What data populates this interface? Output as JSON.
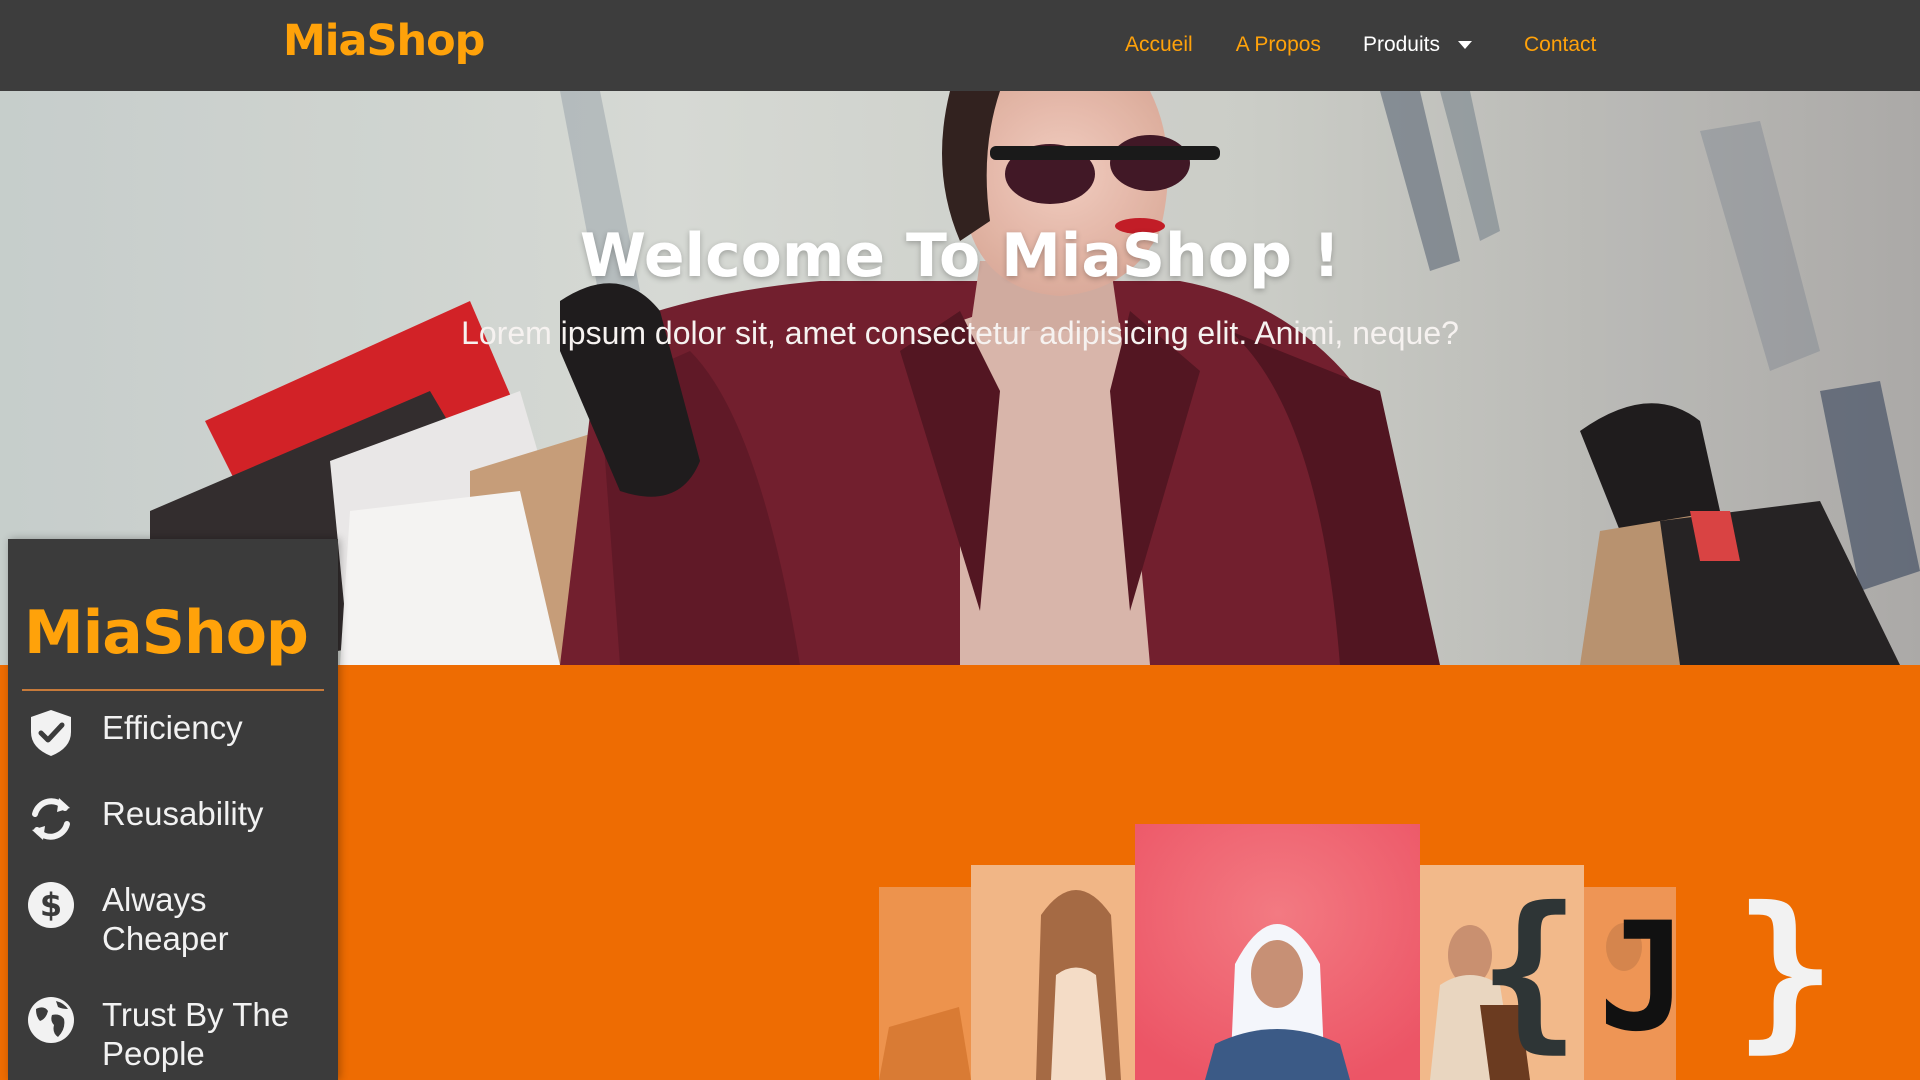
{
  "navbar": {
    "brand": "MiaShop",
    "links": [
      {
        "label": "Accueil"
      },
      {
        "label": "A Propos"
      },
      {
        "label": "Produits"
      },
      {
        "label": "Contact"
      }
    ]
  },
  "hero": {
    "title": "Welcome To MiaShop !",
    "subtitle": "Lorem ipsum dolor sit, amet consectetur adipisicing elit. Animi, neque?"
  },
  "side_card": {
    "brand": "MiaShop",
    "features": [
      {
        "label": "Efficiency",
        "icon": "shield-check-icon"
      },
      {
        "label": "Reusability",
        "icon": "refresh-icon"
      },
      {
        "label": "Always Cheaper",
        "icon": "dollar-icon"
      },
      {
        "label": "Trust By The People",
        "icon": "globe-icon"
      }
    ]
  },
  "logo": {
    "left_brace": "{",
    "letter": "J",
    "right_brace": "}"
  },
  "colors": {
    "navbar_bg": "#3d3d3d",
    "brand": "#ffa20a",
    "orange_section": "#ee6c02",
    "side_card_bg": "#3b3b3b"
  }
}
